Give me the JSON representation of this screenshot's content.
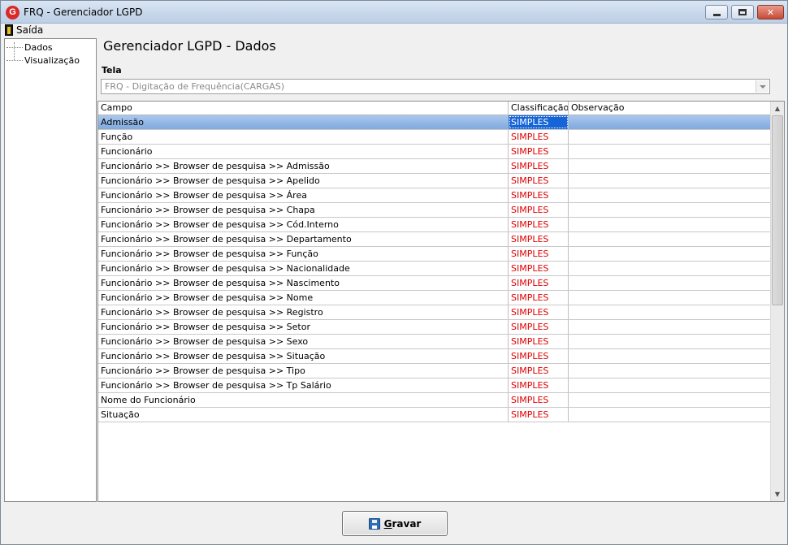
{
  "window": {
    "title": "FRQ - Gerenciador LGPD",
    "app_icon_letter": "G"
  },
  "menu": {
    "exit_label": "Saída"
  },
  "tree": {
    "items": [
      {
        "label": "Dados"
      },
      {
        "label": "Visualização"
      }
    ]
  },
  "main": {
    "heading": "Gerenciador LGPD - Dados",
    "tela_label": "Tela",
    "tela_value": "FRQ - Digitação de Frequência(CARGAS)"
  },
  "grid": {
    "columns": [
      "Campo",
      "Classificação",
      "Observação"
    ],
    "rows": [
      {
        "campo": "Admissão",
        "classificacao": "SIMPLES",
        "observacao": ""
      },
      {
        "campo": "Função",
        "classificacao": "SIMPLES",
        "observacao": ""
      },
      {
        "campo": "Funcionário",
        "classificacao": "SIMPLES",
        "observacao": ""
      },
      {
        "campo": "Funcionário >> Browser de pesquisa >> Admissão",
        "classificacao": "SIMPLES",
        "observacao": ""
      },
      {
        "campo": "Funcionário >> Browser de pesquisa >> Apelido",
        "classificacao": "SIMPLES",
        "observacao": ""
      },
      {
        "campo": "Funcionário >> Browser de pesquisa >> Área",
        "classificacao": "SIMPLES",
        "observacao": ""
      },
      {
        "campo": "Funcionário >> Browser de pesquisa >> Chapa",
        "classificacao": "SIMPLES",
        "observacao": ""
      },
      {
        "campo": "Funcionário >> Browser de pesquisa >> Cód.Interno",
        "classificacao": "SIMPLES",
        "observacao": ""
      },
      {
        "campo": "Funcionário >> Browser de pesquisa >> Departamento",
        "classificacao": "SIMPLES",
        "observacao": ""
      },
      {
        "campo": "Funcionário >> Browser de pesquisa >> Função",
        "classificacao": "SIMPLES",
        "observacao": ""
      },
      {
        "campo": "Funcionário >> Browser de pesquisa >> Nacionalidade",
        "classificacao": "SIMPLES",
        "observacao": ""
      },
      {
        "campo": "Funcionário >> Browser de pesquisa >> Nascimento",
        "classificacao": "SIMPLES",
        "observacao": ""
      },
      {
        "campo": "Funcionário >> Browser de pesquisa >> Nome",
        "classificacao": "SIMPLES",
        "observacao": ""
      },
      {
        "campo": "Funcionário >> Browser de pesquisa >> Registro",
        "classificacao": "SIMPLES",
        "observacao": ""
      },
      {
        "campo": "Funcionário >> Browser de pesquisa >> Setor",
        "classificacao": "SIMPLES",
        "observacao": ""
      },
      {
        "campo": "Funcionário >> Browser de pesquisa >> Sexo",
        "classificacao": "SIMPLES",
        "observacao": ""
      },
      {
        "campo": "Funcionário >> Browser de pesquisa >> Situação",
        "classificacao": "SIMPLES",
        "observacao": ""
      },
      {
        "campo": "Funcionário >> Browser de pesquisa >> Tipo",
        "classificacao": "SIMPLES",
        "observacao": ""
      },
      {
        "campo": "Funcionário >> Browser de pesquisa >> Tp Salário",
        "classificacao": "SIMPLES",
        "observacao": ""
      },
      {
        "campo": "Nome do Funcionário",
        "classificacao": "SIMPLES",
        "observacao": ""
      },
      {
        "campo": "Situação",
        "classificacao": "SIMPLES",
        "observacao": ""
      }
    ]
  },
  "footer": {
    "save_label_first": "G",
    "save_label_rest": "ravar"
  },
  "colors": {
    "classification": "#e00000",
    "selection": "#1565d8"
  }
}
